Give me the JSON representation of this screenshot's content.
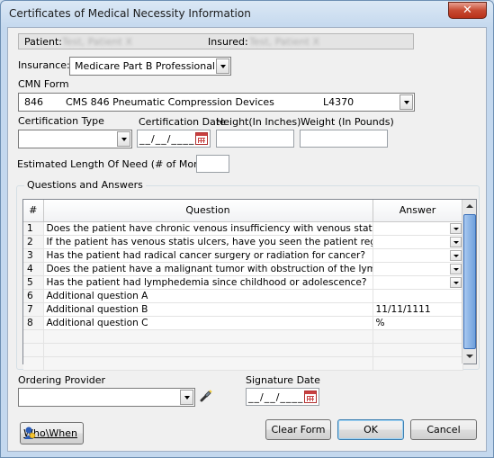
{
  "window": {
    "title": "Certificates of Medical Necessity Information",
    "close_label": "✕"
  },
  "patient": {
    "patient_label": "Patient:",
    "patient_value": "Test, Patient X",
    "insured_label": "Insured:",
    "insured_value": "Test, Patient X"
  },
  "insurance": {
    "label": "Insurance:",
    "value": "Medicare Part B Professional"
  },
  "cmn_form": {
    "label": "CMN Form",
    "code": "846",
    "name": "CMS 846 Pneumatic Compression Devices",
    "hcpcs": "L4370"
  },
  "certification": {
    "type_label": "Certification Type",
    "type_value": "",
    "date_label": "Certification Date",
    "date_value": "__/__/____",
    "height_label": "Height(In Inches)",
    "height_value": "",
    "weight_label": "Weight (In Pounds)",
    "weight_value": ""
  },
  "length_of_need": {
    "label": "Estimated Length Of Need (# of Months):",
    "value": ""
  },
  "qa": {
    "group_title": "Questions and Answers",
    "columns": {
      "num": "#",
      "question": "Question",
      "answer": "Answer"
    },
    "rows": [
      {
        "num": "1",
        "question": "Does the patient have chronic venous insufficiency with venous statis ulcers",
        "answer": "",
        "dropdown": true
      },
      {
        "num": "2",
        "question": "If the patient has venous statis ulcers, have you seen the patient regularly?",
        "answer": "",
        "dropdown": true
      },
      {
        "num": "3",
        "question": "Has the patient had radical cancer surgery or radiation for cancer?",
        "answer": "",
        "dropdown": true
      },
      {
        "num": "4",
        "question": "Does the patient have a malignant tumor with obstruction of the lymphatic no",
        "answer": "",
        "dropdown": true
      },
      {
        "num": "5",
        "question": "Has the patient had lymphedemia since childhood or adolescence?",
        "answer": "",
        "dropdown": true
      },
      {
        "num": "6",
        "question": "Additional question A",
        "answer": "",
        "dropdown": false
      },
      {
        "num": "7",
        "question": "Additional question B",
        "answer": "11/11/1111",
        "dropdown": false
      },
      {
        "num": "8",
        "question": "Additional question C",
        "answer": "%",
        "dropdown": false
      }
    ]
  },
  "ordering_provider": {
    "label": "Ordering Provider",
    "value": ""
  },
  "signature_date": {
    "label": "Signature Date",
    "value": "__/__/____"
  },
  "buttons": {
    "who_when": "Who\\When",
    "clear_form": "Clear Form",
    "ok": "OK",
    "cancel": "Cancel"
  }
}
